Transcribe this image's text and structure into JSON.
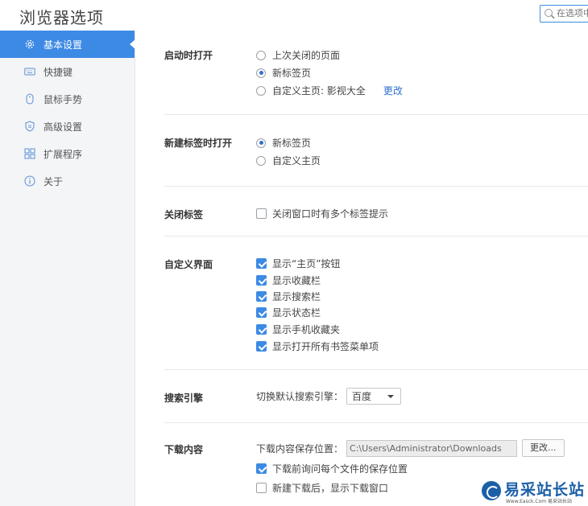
{
  "app": {
    "title": "浏览器选项"
  },
  "search": {
    "placeholder": "在选项中"
  },
  "sidebar": {
    "items": [
      {
        "label": "基本设置",
        "icon": "gear-icon",
        "active": true
      },
      {
        "label": "快捷键",
        "icon": "keyboard-icon",
        "active": false
      },
      {
        "label": "鼠标手势",
        "icon": "mouse-icon",
        "active": false
      },
      {
        "label": "高级设置",
        "icon": "shield-icon",
        "active": false
      },
      {
        "label": "扩展程序",
        "icon": "extensions-icon",
        "active": false
      },
      {
        "label": "关于",
        "icon": "info-icon",
        "active": false
      }
    ]
  },
  "sections": {
    "startup": {
      "label": "启动时打开",
      "options": [
        {
          "label": "上次关闭的页面",
          "selected": false
        },
        {
          "label": "新标签页",
          "selected": true
        },
        {
          "label": "自定义主页: 影视大全",
          "selected": false
        }
      ],
      "change_link": "更改"
    },
    "new_tab": {
      "label": "新建标签时打开",
      "options": [
        {
          "label": "新标签页",
          "selected": true
        },
        {
          "label": "自定义主页",
          "selected": false
        }
      ]
    },
    "close_tab": {
      "label": "关闭标签",
      "options": [
        {
          "label": "关闭窗口时有多个标签提示",
          "checked": false
        }
      ]
    },
    "custom_ui": {
      "label": "自定义界面",
      "options": [
        {
          "label": "显示“主页”按钮",
          "checked": true
        },
        {
          "label": "显示收藏栏",
          "checked": true
        },
        {
          "label": "显示搜索栏",
          "checked": true
        },
        {
          "label": "显示状态栏",
          "checked": true
        },
        {
          "label": "显示手机收藏夹",
          "checked": true
        },
        {
          "label": "显示打开所有书签菜单项",
          "checked": true
        }
      ]
    },
    "search_engine": {
      "label": "搜索引擎",
      "prompt": "切换默认搜索引擎：",
      "selected": "百度"
    },
    "downloads": {
      "label": "下载内容",
      "location_label": "下载内容保存位置：",
      "location_value": "C:\\Users\\Administrator\\Downloads",
      "change_button": "更改...",
      "options": [
        {
          "label": "下载前询问每个文件的保存位置",
          "checked": true
        },
        {
          "label": "新建下载后，显示下载窗口",
          "checked": false
        }
      ]
    }
  },
  "watermark": {
    "text": "易采站长站",
    "sub": "Www.Easck.Com 易采站长站"
  },
  "colors": {
    "accent": "#3d8ae5",
    "link": "#2f6fd0",
    "sidebar_bg": "#f3f5f7"
  }
}
